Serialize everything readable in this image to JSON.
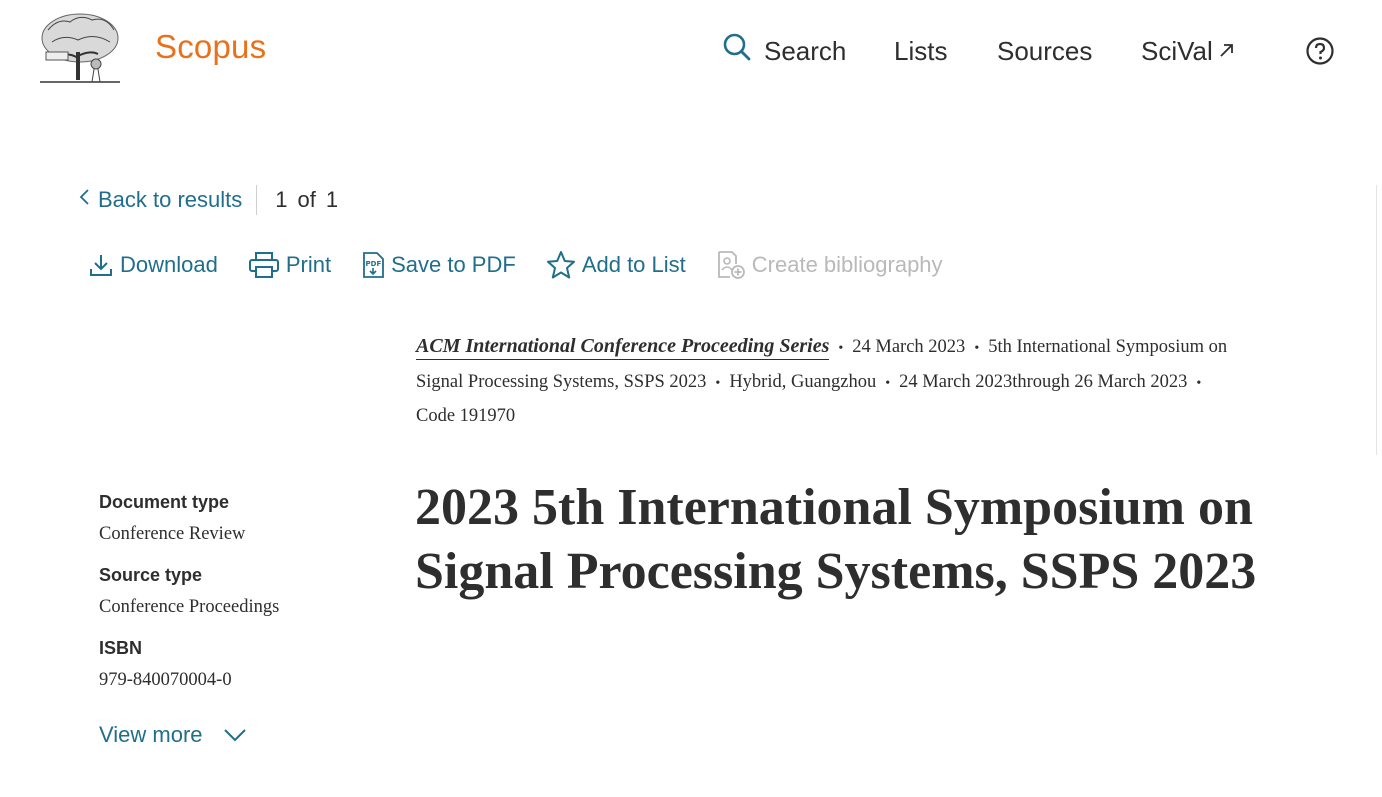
{
  "header": {
    "brand": "Scopus",
    "nav": {
      "search": "Search",
      "lists": "Lists",
      "sources": "Sources",
      "scival": "SciVal"
    }
  },
  "back_row": {
    "back_label": "Back to results",
    "page_current": "1",
    "page_of": "of",
    "page_total": "1"
  },
  "toolbar": {
    "download": "Download",
    "print": "Print",
    "save_pdf": "Save to PDF",
    "add_list": "Add to List",
    "create_bib": "Create bibliography"
  },
  "meta": {
    "series": "ACM International Conference Proceeding Series",
    "date": "24 March 2023",
    "conference_part1": "5th International Symposium on",
    "conference_part2": "Signal Processing Systems, SSPS 2023",
    "location": "Hybrid, Guangzhou",
    "dates": "24 March 2023through 26 March 2023",
    "code": "Code 191970"
  },
  "info": {
    "doc_type_label": "Document type",
    "doc_type_value": "Conference Review",
    "source_type_label": "Source type",
    "source_type_value": "Conference Proceedings",
    "isbn_label": "ISBN",
    "isbn_value": "979-840070004-0",
    "view_more": "View more"
  },
  "title": {
    "line1": "2023 5th International Symposium on",
    "line2": "Signal Processing Systems, SSPS 2023"
  },
  "colors": {
    "brand": "#e9711c",
    "link": "#1f6e8c",
    "text": "#2e2e2e",
    "disabled": "#b9b9b9"
  }
}
